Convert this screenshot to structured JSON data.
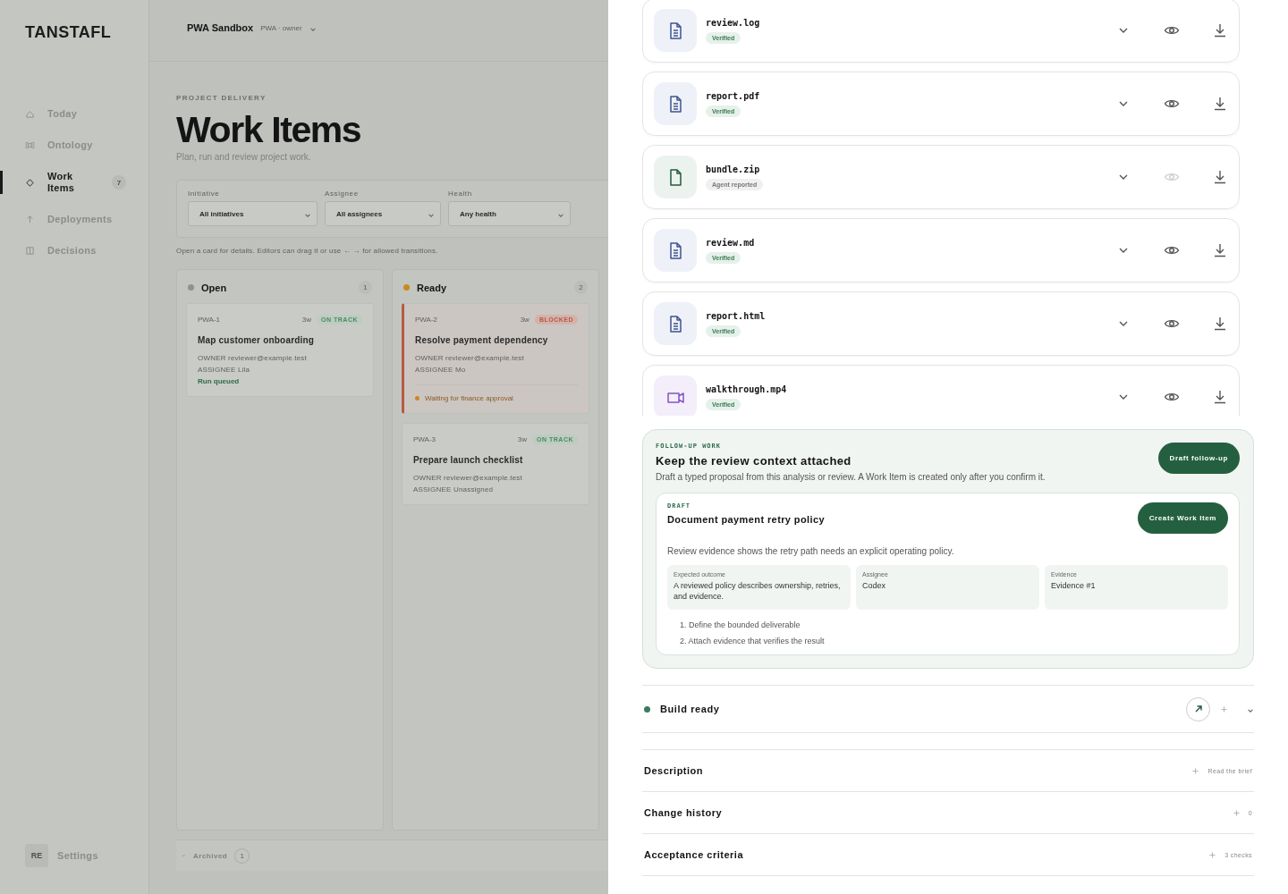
{
  "sidebar": {
    "logo": "TANSTAFL",
    "items": [
      {
        "label": "Today",
        "selected": false
      },
      {
        "label": "Ontology",
        "selected": false
      },
      {
        "label": "Work Items",
        "selected": true,
        "count": "7"
      },
      {
        "label": "Deployments",
        "selected": false
      },
      {
        "label": "Decisions",
        "selected": false
      }
    ],
    "user": {
      "initials": "RE",
      "label": "Settings"
    }
  },
  "header": {
    "project": "PWA Sandbox",
    "role": "PWA · owner"
  },
  "page": {
    "eyebrow": "PROJECT DELIVERY",
    "title": "Work Items",
    "subtitle": "Plan, run and review project work."
  },
  "filters": [
    {
      "label": "Initiative",
      "value": "All initiatives"
    },
    {
      "label": "Assignee",
      "value": "All assignees"
    },
    {
      "label": "Health",
      "value": "Any health"
    }
  ],
  "hint": "Open a card for details. Editors can drag it or use ← → for allowed transitions.",
  "board": {
    "columns": [
      {
        "title": "Open",
        "color": "#8e918d",
        "count": "1",
        "cards": [
          {
            "id": "PWA-1",
            "age": "3w",
            "health": {
              "label": "ON TRACK",
              "kind": "on_track"
            },
            "title": "Map customer onboarding",
            "owner": "OWNER reviewer@example.test",
            "assignee": "ASSIGNEE Lila",
            "status": "Run queued",
            "blocked": false
          }
        ]
      },
      {
        "title": "Ready",
        "color": "#c98a1e",
        "count": "2",
        "cards": [
          {
            "id": "PWA-2",
            "age": "3w",
            "health": {
              "label": "BLOCKED",
              "kind": "blocked"
            },
            "title": "Resolve payment dependency",
            "owner": "OWNER reviewer@example.test",
            "assignee": "ASSIGNEE Mo",
            "note": "Waiting for finance approval",
            "blocked": true
          },
          {
            "id": "PWA-3",
            "age": "3w",
            "health": {
              "label": "ON TRACK",
              "kind": "on_track"
            },
            "title": "Prepare launch checklist",
            "owner": "OWNER reviewer@example.test",
            "assignee": "ASSIGNEE Unassigned",
            "blocked": false
          }
        ]
      }
    ],
    "archived": {
      "label": "Archived",
      "count": "1"
    }
  },
  "drawer": {
    "files": [
      {
        "name": "review.log",
        "kind": "document",
        "badge": {
          "label": "Verified",
          "kind": "verified"
        },
        "preview_disabled": false
      },
      {
        "name": "report.pdf",
        "kind": "document",
        "badge": {
          "label": "Verified",
          "kind": "verified"
        },
        "preview_disabled": false
      },
      {
        "name": "bundle.zip",
        "kind": "archive",
        "badge": {
          "label": "Agent reported",
          "kind": "reported"
        },
        "preview_disabled": true
      },
      {
        "name": "review.md",
        "kind": "document",
        "badge": {
          "label": "Verified",
          "kind": "verified"
        },
        "preview_disabled": false
      },
      {
        "name": "report.html",
        "kind": "document",
        "badge": {
          "label": "Verified",
          "kind": "verified"
        },
        "preview_disabled": false
      },
      {
        "name": "walkthrough.mp4",
        "kind": "video",
        "badge": {
          "label": "Verified",
          "kind": "verified"
        },
        "preview_disabled": false
      }
    ],
    "follow_up": {
      "eyebrow": "FOLLOW-UP WORK",
      "title": "Keep the review context attached",
      "body": "Draft a typed proposal from this analysis or review. A Work Item is created only after you confirm it.",
      "action": "Draft follow-up",
      "draft": {
        "eyebrow": "DRAFT",
        "title": "Document payment retry policy",
        "action": "Create Work Item",
        "summary": "Review evidence shows the retry path needs an explicit operating policy.",
        "fields": [
          {
            "label": "Expected outcome",
            "value": "A reviewed policy describes ownership, retries, and evidence."
          },
          {
            "label": "Assignee",
            "value": "Codex"
          },
          {
            "label": "Evidence",
            "value": "Evidence #1"
          }
        ],
        "steps": [
          "1. Define the bounded deliverable",
          "2. Attach evidence that verifies the result"
        ]
      }
    },
    "build": {
      "label": "Build ready"
    },
    "sections": [
      {
        "title": "Description",
        "meta": "Read the brief"
      },
      {
        "title": "Change history",
        "meta": "0"
      },
      {
        "title": "Acceptance criteria",
        "meta": "3 checks"
      }
    ]
  }
}
